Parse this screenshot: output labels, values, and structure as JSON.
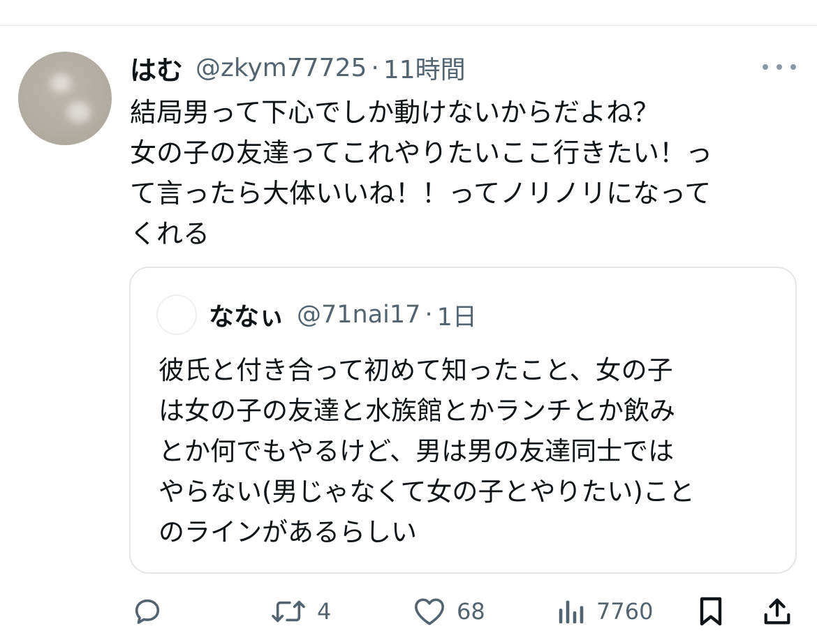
{
  "tweet": {
    "author": {
      "display_name": "はむ",
      "handle": "@zkym77725",
      "time": "11時間"
    },
    "separator": "·",
    "text": "結局男って下心でしか動けないからだよね？\n女の子の友達ってこれやりたいここ行きたい！っ\nて言ったら大体いいね！！ってノリノリになって\nくれる",
    "more_icon": "more-horizontal-icon"
  },
  "quote": {
    "author": {
      "display_name": "ななぃ",
      "handle": "@71nai17",
      "time": "1日"
    },
    "separator": "·",
    "text": "彼氏と付き合って初めて知ったこと、女の子\nは女の子の友達と水族館とかランチとか飲み\nとか何でもやるけど、男は男の友達同士では\nやらない(男じゃなくて女の子とやりたい)こと\nのラインがあるらしい"
  },
  "actions": {
    "reply": {
      "icon": "reply-icon",
      "count": ""
    },
    "retweet": {
      "icon": "retweet-icon",
      "count": "4"
    },
    "like": {
      "icon": "heart-icon",
      "count": "68"
    },
    "views": {
      "icon": "views-icon",
      "count": "7760"
    },
    "bookmark": {
      "icon": "bookmark-icon"
    },
    "share": {
      "icon": "share-icon"
    }
  },
  "colors": {
    "text": "#0f1419",
    "secondary": "#536471",
    "border": "#e3e6e8"
  }
}
